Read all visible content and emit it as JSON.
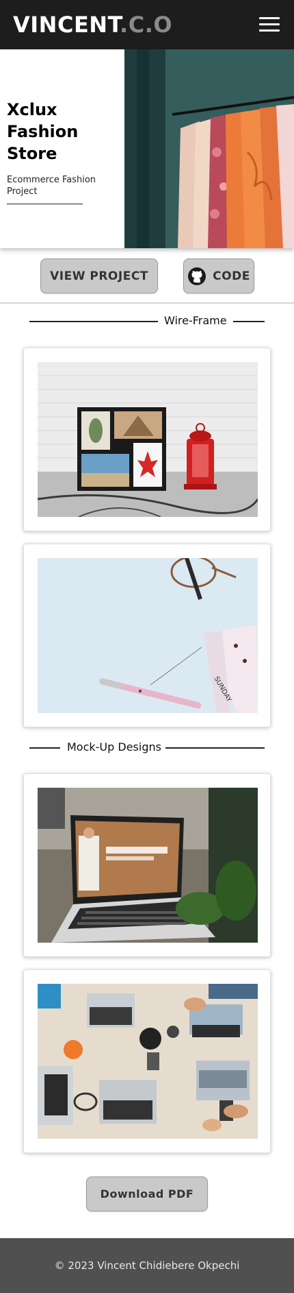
{
  "header": {
    "brand_main": "VINCENT",
    "brand_suffix": ".C.O",
    "menu_icon": "hamburger-menu-icon"
  },
  "hero": {
    "title": "Xclux Fashion Store",
    "subtitle": "Ecommerce Fashion Project",
    "image": "clothing-rack-photo"
  },
  "actions": {
    "view_project": "VIEW PROJECT",
    "code": "CODE",
    "code_icon": "github-icon"
  },
  "sections": [
    {
      "heading": "Wire-Frame",
      "images": [
        "photo-frames-and-lantern",
        "glasses-pen-and-notepad"
      ]
    },
    {
      "heading": "Mock-Up Designs",
      "images": [
        "laptop-website-mockup",
        "team-laptops-desk"
      ]
    }
  ],
  "pdf_button": "Download PDF",
  "footer": {
    "copyright": "© 2023 Vincent Chidiebere Okpechi"
  },
  "colors": {
    "header_bg": "#1d1d1d",
    "brand_suffix": "#8a8a8a",
    "button_bg": "#c9c9c9",
    "footer_bg": "#505050"
  }
}
